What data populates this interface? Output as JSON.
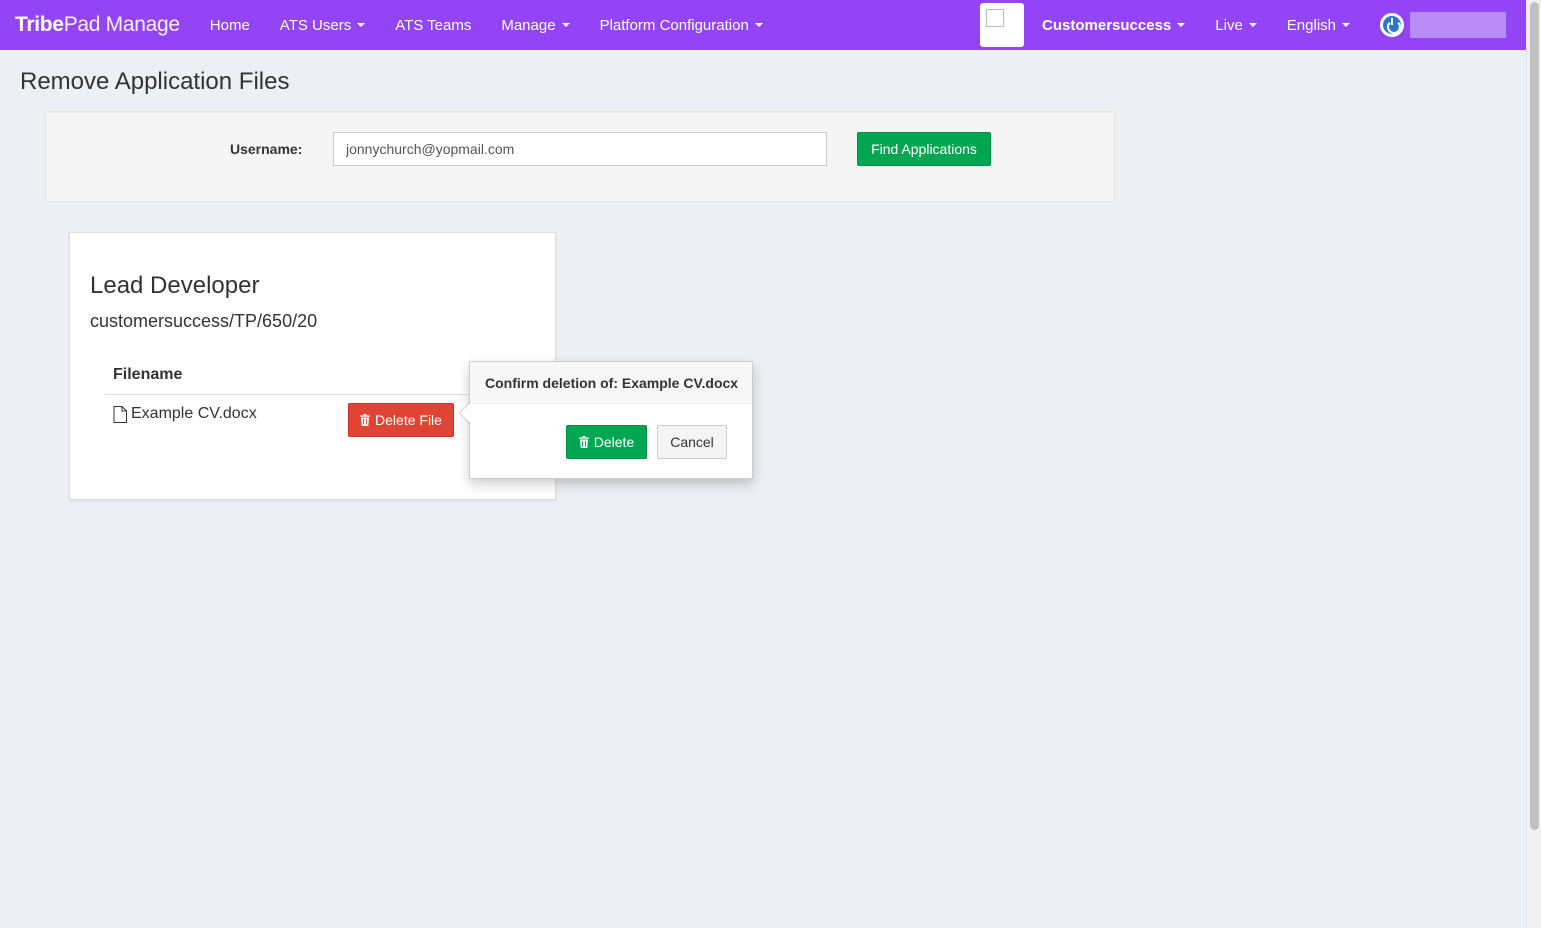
{
  "navbar": {
    "brand_bold": "Tribe",
    "brand_light": "Pad Manage",
    "items": [
      {
        "label": "Home",
        "dropdown": false
      },
      {
        "label": "ATS Users",
        "dropdown": true
      },
      {
        "label": "ATS Teams",
        "dropdown": false
      },
      {
        "label": "Manage",
        "dropdown": true
      },
      {
        "label": "Platform Configuration",
        "dropdown": true
      }
    ],
    "right": {
      "client": "Customersuccess",
      "environment": "Live",
      "language": "English"
    },
    "colors": {
      "bar": "#9345f5"
    }
  },
  "page": {
    "title": "Remove Application Files"
  },
  "search": {
    "label": "Username:",
    "value": "jonnychurch@yopmail.com",
    "button": "Find Applications"
  },
  "application": {
    "title": "Lead Developer",
    "reference": "customersuccess/TP/650/20",
    "column_header": "Filename",
    "files": [
      {
        "name": "Example CV.docx",
        "delete_label": "Delete File"
      }
    ]
  },
  "popover": {
    "title": "Confirm deletion of: Example CV.docx",
    "delete_label": "Delete",
    "cancel_label": "Cancel"
  },
  "icons": [
    "file-icon",
    "trash-icon",
    "power-icon",
    "chevron-down-icon"
  ]
}
